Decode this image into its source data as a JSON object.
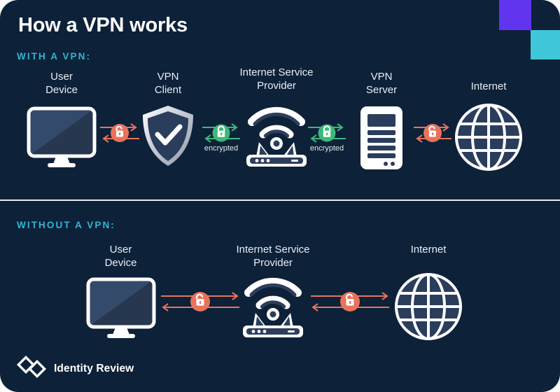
{
  "title": "How a VPN works",
  "sections": {
    "with": {
      "label": "WITH A VPN:",
      "nodes": [
        {
          "name": "user-device",
          "label": "User\nDevice",
          "icon": "monitor-icon"
        },
        {
          "name": "vpn-client",
          "label": "VPN\nClient",
          "icon": "shield-check-icon"
        },
        {
          "name": "isp",
          "label": "Internet Service\nProvider",
          "icon": "router-wifi-icon"
        },
        {
          "name": "vpn-server",
          "label": "VPN\nServer",
          "icon": "server-icon"
        },
        {
          "name": "internet",
          "label": "Internet",
          "icon": "globe-icon"
        }
      ],
      "connectors": [
        {
          "name": "connector-unencrypted-1",
          "state": "unlocked",
          "caption": ""
        },
        {
          "name": "connector-encrypted-1",
          "state": "locked",
          "caption": "encrypted"
        },
        {
          "name": "connector-encrypted-2",
          "state": "locked",
          "caption": "encrypted"
        },
        {
          "name": "connector-unencrypted-2",
          "state": "unlocked",
          "caption": ""
        }
      ]
    },
    "without": {
      "label": "WITHOUT A VPN:",
      "nodes": [
        {
          "name": "user-device",
          "label": "User\nDevice",
          "icon": "monitor-icon"
        },
        {
          "name": "isp",
          "label": "Internet Service\nProvider",
          "icon": "router-wifi-icon"
        },
        {
          "name": "internet",
          "label": "Internet",
          "icon": "globe-icon"
        }
      ],
      "connectors": [
        {
          "name": "connector-unlocked-1",
          "state": "unlocked",
          "caption": ""
        },
        {
          "name": "connector-unlocked-2",
          "state": "unlocked",
          "caption": ""
        }
      ]
    }
  },
  "footer": {
    "brand": "Identity Review",
    "logo_icon": "double-diamond-logo-icon"
  },
  "colors": {
    "background": "#0d2139",
    "accent_cyan": "#30b6d4",
    "accent_purple": "#6135f0",
    "deco_cyan": "#3fc6d8",
    "unlocked_coral": "#e8735c",
    "locked_green": "#3cb878",
    "icon_white": "#ffffff",
    "icon_fill_navy": "#2c3e5c",
    "text_light": "#e9eef5"
  }
}
